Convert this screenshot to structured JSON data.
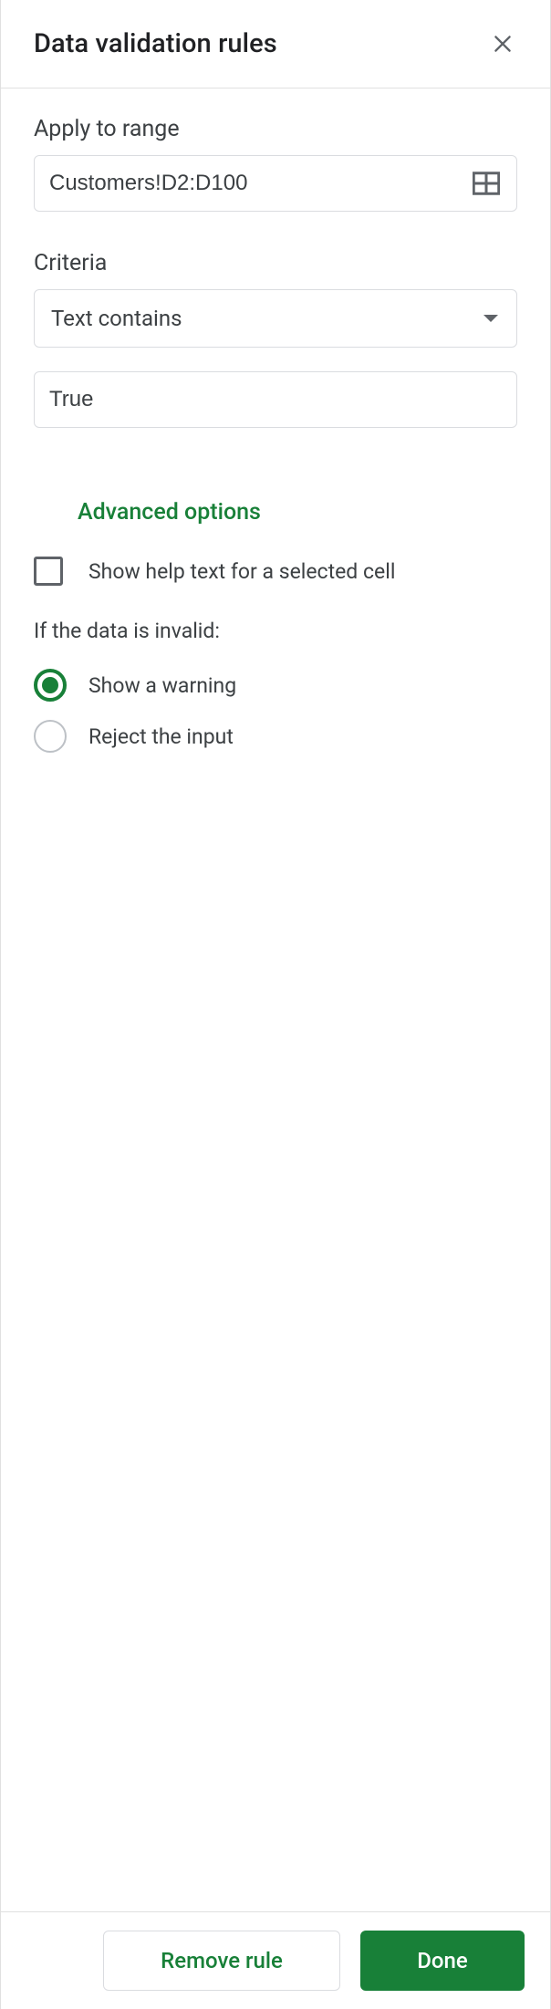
{
  "header": {
    "title": "Data validation rules"
  },
  "apply": {
    "label": "Apply to range",
    "value": "Customers!D2:D100"
  },
  "criteria": {
    "label": "Criteria",
    "selected": "Text contains",
    "value": "True"
  },
  "advanced_label": "Advanced options",
  "help_text": {
    "label": "Show help text for a selected cell",
    "checked": false
  },
  "invalid": {
    "label": "If the data is invalid:",
    "options": [
      {
        "label": "Show a warning",
        "selected": true
      },
      {
        "label": "Reject the input",
        "selected": false
      }
    ]
  },
  "footer": {
    "remove": "Remove rule",
    "done": "Done"
  }
}
